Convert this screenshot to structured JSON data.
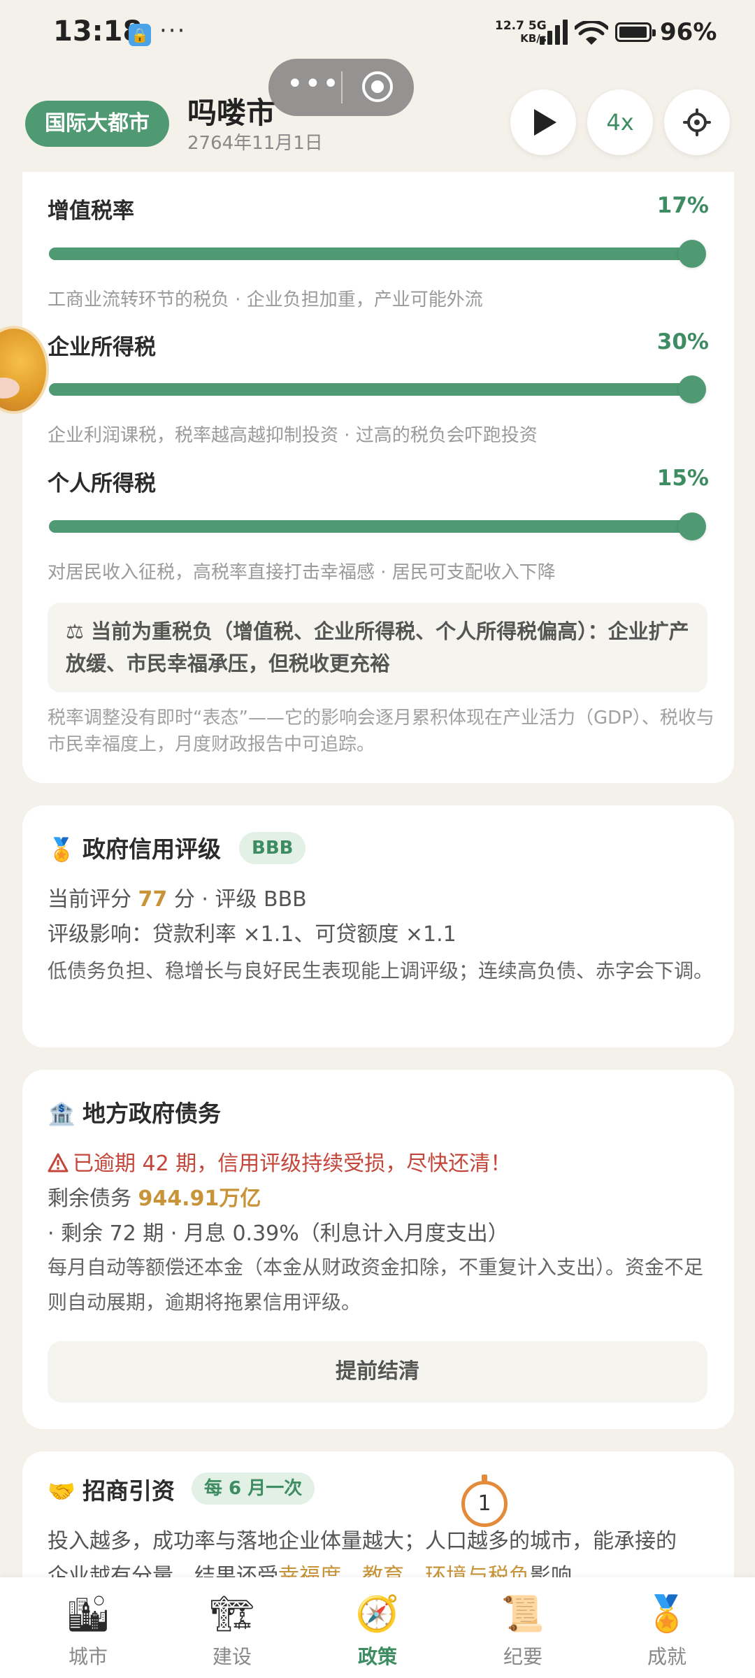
{
  "status_bar": {
    "time": "13:18",
    "speed_value": "12.7",
    "speed_unit": "KB/s",
    "network": "5G",
    "battery": "96%"
  },
  "header": {
    "city_level": "国际大都市",
    "city_name": "吗喽市",
    "date": "2764年11月1日",
    "speed_multiplier": "4x"
  },
  "tax": {
    "items": [
      {
        "label": "增值税率",
        "value": "17%",
        "level": 1.0,
        "desc": "工商业流转环节的税负 · 企业负担加重，产业可能外流"
      },
      {
        "label": "企业所得税",
        "value": "30%",
        "level": 1.0,
        "desc": "企业利润课税，税率越高越抑制投资 · 过高的税负会吓跑投资"
      },
      {
        "label": "个人所得税",
        "value": "15%",
        "level": 1.0,
        "desc": "对居民收入征税，高税率直接打击幸福感 · 居民可支配收入下降"
      }
    ],
    "note_icon": "⚖",
    "note": "当前为重税负（增值税、企业所得税、个人所得税偏高）：企业扩产放缓、市民幸福承压，但税收更充裕",
    "footer": "税率调整没有即时“表态”——它的影响会逐月累积体现在产业活力（GDP）、税收与市民幸福度上，月度财政报告中可追踪。"
  },
  "credit": {
    "icon": "🏅",
    "title": "政府信用评级",
    "grade_badge": "BBB",
    "score_prefix": "当前评分",
    "score": "77",
    "score_suffix": "分 · 评级 BBB",
    "effect": "评级影响：贷款利率 ×1.1、可贷额度 ×1.1",
    "rule": "低债务负担、稳增长与良好民生表现能上调评级；连续高负债、赤字会下调。"
  },
  "debt": {
    "icon": "🏦",
    "title": "地方政府债务",
    "warning": "已逾期 42 期，信用评级持续受损，尽快还清！",
    "remaining_prefix": "剩余债务",
    "remaining_amount": "944.91万亿",
    "remaining_suffix": "· 剩余 72 期 · 月息 0.39%（利息计入月度支出）",
    "rule": "每月自动等额偿还本金（本金从财政资金扣除，不重复计入支出）。资金不足则自动展期，逾期将拖累信用评级。",
    "settle_button": "提前结清"
  },
  "investment": {
    "icon": "🤝",
    "title": "招商引资",
    "frequency": "每 6 月一次",
    "desc_line1": "投入越多，成功率与落地企业体量越大；人口越多的城市，能承接的",
    "desc_line2_start": "企业越有分量，结果还受",
    "desc_line2_h1": "幸福度",
    "desc_line2_h2": "教育",
    "desc_line2_h3": "环境与税负",
    "desc_line2_end": "影响"
  },
  "floating_badge": "1",
  "bottom_nav": [
    {
      "label": "城市",
      "icon": "🏙"
    },
    {
      "label": "建设",
      "icon": "🏗"
    },
    {
      "label": "政策",
      "icon": "🧭"
    },
    {
      "label": "纪要",
      "icon": "📜"
    },
    {
      "label": "成就",
      "icon": "🏅"
    }
  ],
  "colors": {
    "accent": "#4f9a72",
    "accent_text": "#3e8c62",
    "highlight": "#c79439",
    "warning": "#c4463a",
    "background": "#f4f1ea"
  }
}
